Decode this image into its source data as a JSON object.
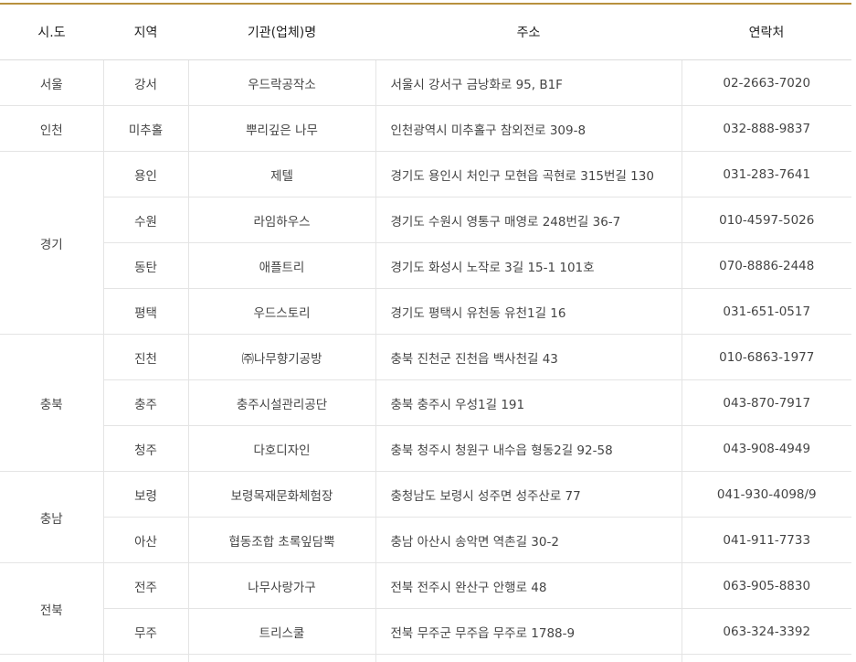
{
  "table": {
    "headers": [
      "시.도",
      "지역",
      "기관(업체)명",
      "주소",
      "연락처"
    ],
    "groups": [
      {
        "region": "서울",
        "rows": [
          {
            "area": "강서",
            "name": "우드락공작소",
            "address": "서울시 강서구 금낭화로 95, B1F",
            "phone": "02-2663-7020"
          }
        ]
      },
      {
        "region": "인천",
        "rows": [
          {
            "area": "미추홀",
            "name": "뿌리깊은 나무",
            "address": "인천광역시 미추홀구 참외전로 309-8",
            "phone": "032-888-9837"
          }
        ]
      },
      {
        "region": "경기",
        "rows": [
          {
            "area": "용인",
            "name": "제텔",
            "address": "경기도 용인시 처인구 모현읍 곡현로 315번길 130",
            "phone": "031-283-7641"
          },
          {
            "area": "수원",
            "name": "라임하우스",
            "address": "경기도 수원시 영통구 매영로 248번길 36-7",
            "phone": "010-4597-5026"
          },
          {
            "area": "동탄",
            "name": "애플트리",
            "address": "경기도 화성시 노작로 3길 15-1 101호",
            "phone": "070-8886-2448"
          },
          {
            "area": "평택",
            "name": "우드스토리",
            "address": "경기도 평택시 유천동 유천1길 16",
            "phone": "031-651-0517"
          }
        ]
      },
      {
        "region": "충북",
        "rows": [
          {
            "area": "진천",
            "name": "㈜나무향기공방",
            "address": "충북 진천군 진천읍 백사천길 43",
            "phone": "010-6863-1977"
          },
          {
            "area": "충주",
            "name": "충주시설관리공단",
            "address": "충북 충주시 우성1길 191",
            "phone": "043-870-7917"
          },
          {
            "area": "청주",
            "name": "다호디자인",
            "address": "충북 청주시 청원구 내수읍 형동2길 92-58",
            "phone": "043-908-4949"
          }
        ]
      },
      {
        "region": "충남",
        "rows": [
          {
            "area": "보령",
            "name": "보령목재문화체험장",
            "address": "충청남도 보령시 성주면 성주산로 77",
            "phone": "041-930-4098/9"
          },
          {
            "area": "아산",
            "name": "협동조합 초록잎담뿍",
            "address": "충남 아산시 송악면 역촌길 30-2",
            "phone": "041-911-7733"
          }
        ]
      },
      {
        "region": "전북",
        "rows": [
          {
            "area": "전주",
            "name": "나무사랑가구",
            "address": "전북 전주시 완산구 안행로 48",
            "phone": "063-905-8830"
          },
          {
            "area": "무주",
            "name": "트리스쿨",
            "address": "전북 무주군 무주읍 무주로 1788-9",
            "phone": "063-324-3392"
          }
        ]
      }
    ]
  },
  "colors": {
    "accent_border": "#b8913e",
    "text": "#444444",
    "grid": "#e4e4e4"
  }
}
